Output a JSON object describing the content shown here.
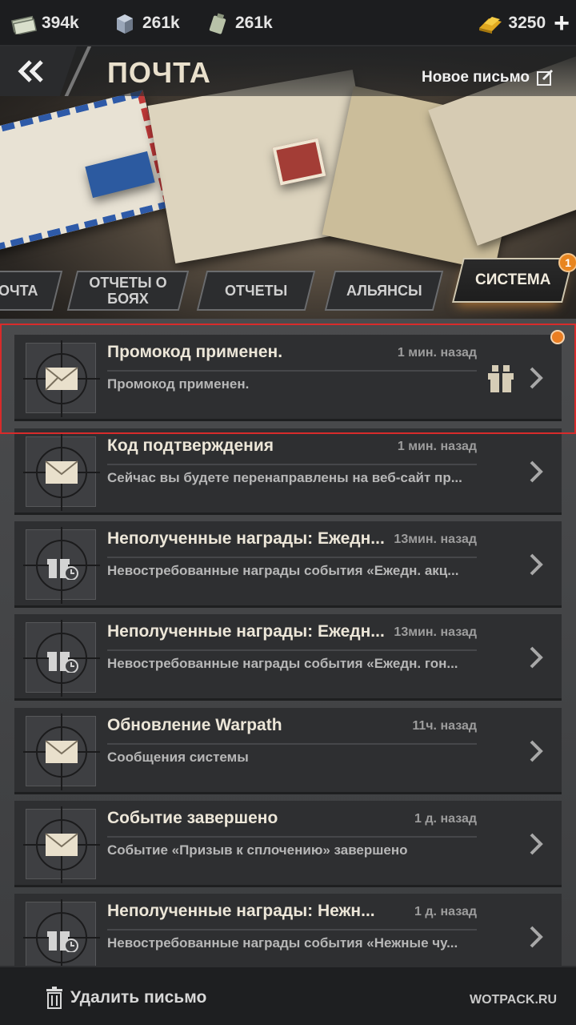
{
  "resources": {
    "cash": "394k",
    "steel": "261k",
    "oil": "261k",
    "gold": "3250"
  },
  "header": {
    "title": "ПОЧТА",
    "new_mail": "Новое письмо"
  },
  "tabs": [
    {
      "label": "ПОЧТА"
    },
    {
      "label": "ОТЧЕТЫ О БОЯХ"
    },
    {
      "label": "ОТЧЕТЫ"
    },
    {
      "label": "АЛЬЯНСЫ"
    },
    {
      "label": "СИСТЕМА",
      "active": true,
      "badge": "1"
    }
  ],
  "mails": [
    {
      "subject": "Промокод применен.",
      "time": "1 мин. назад",
      "preview": "Промокод применен.",
      "icon": "envelope-icon",
      "attachment": true,
      "unread": true
    },
    {
      "subject": "Код подтверждения",
      "time": "1 мин. назад",
      "preview": "Сейчас вы будете перенаправлены на веб-сайт пр...",
      "icon": "envelope-icon"
    },
    {
      "subject": "Неполученные награды: Ежедн...",
      "time": "13мин. назад",
      "preview": "Невостребованные награды события «Ежедн. акц...",
      "icon": "gift-clock-icon"
    },
    {
      "subject": "Неполученные награды: Ежедн...",
      "time": "13мин. назад",
      "preview": "Невостребованные награды события «Ежедн. гон...",
      "icon": "gift-clock-icon"
    },
    {
      "subject": "Обновление Warpath",
      "time": "11ч. назад",
      "preview": "Сообщения системы",
      "icon": "envelope-icon"
    },
    {
      "subject": "Событие завершено",
      "time": "1 д. назад",
      "preview": "Событие «Призыв к сплочению» завершено",
      "icon": "envelope-icon"
    },
    {
      "subject": "Неполученные награды: Нежн...",
      "time": "1 д. назад",
      "preview": "Невостребованные награды события «Нежные чу...",
      "icon": "gift-clock-icon"
    }
  ],
  "footer": {
    "delete_label": "Удалить письмо",
    "watermark": "WOTPACK.RU"
  },
  "colors": {
    "accent": "#ea7e23",
    "highlight": "#d82b2b"
  }
}
